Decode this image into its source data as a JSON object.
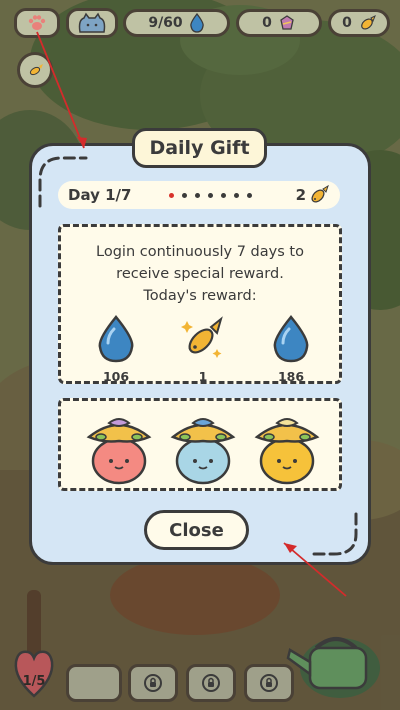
{
  "hud": {
    "water_count": "9/60",
    "gem_count": "0",
    "fish_count": "0"
  },
  "dialog": {
    "title": "Daily Gift",
    "day_label": "Day 1/7",
    "days_total": 7,
    "active_day_index": 0,
    "fish_reward_count": "2",
    "description_lines": [
      "Login continuously 7 days to",
      "receive special reward.",
      "Today's reward:"
    ],
    "rewards": [
      {
        "icon": "water-drop-icon",
        "value": "106"
      },
      {
        "icon": "fish-icon",
        "value": "1"
      },
      {
        "icon": "water-drop-icon",
        "value": "186"
      }
    ],
    "plants": [
      {
        "icon": "pink-plant-icon",
        "color": "#f48a82"
      },
      {
        "icon": "blue-plant-icon",
        "color": "#a9d6e6"
      },
      {
        "icon": "yellow-plant-icon",
        "color": "#f6c23a"
      }
    ],
    "close_label": "Close"
  },
  "bottom": {
    "heart_label": "1/5"
  },
  "colors": {
    "dialog_bg": "#d5e6f5",
    "cream": "#fffbea",
    "outline": "#3b3b3b",
    "annotation_red": "#d42b2b"
  }
}
